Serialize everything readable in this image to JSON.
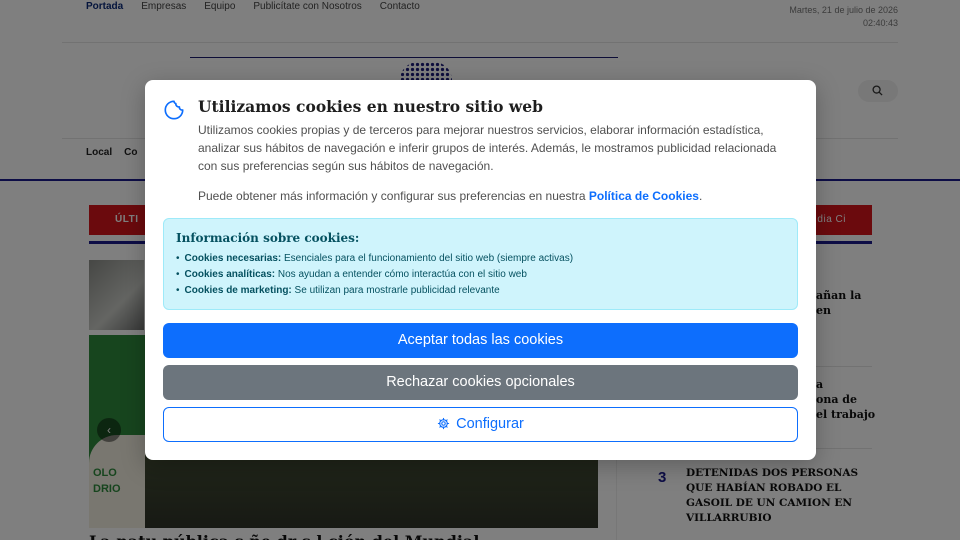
{
  "topnav": {
    "items": [
      "Portada",
      "Empresas",
      "Equipo",
      "Publicítate con Nosotros",
      "Contacto"
    ],
    "active": "Portada"
  },
  "datetime": {
    "date": "Martes, 21 de julio de 2026",
    "time": "02:40:43"
  },
  "mainnav": {
    "items": [
      "Local",
      "Co"
    ]
  },
  "ticker": {
    "label": "ÚLTI",
    "right_text": "dia Ci"
  },
  "main_article": {
    "image_text": "OLO\nDRIO",
    "headline_fragment": "La  natu  pública  s  ñe  dr  s  l  ción del Mundial"
  },
  "sidebar": {
    "fragments": [
      "añan la",
      "en",
      "a",
      "ona de",
      "el trabajo"
    ],
    "ranked": [
      {
        "rank": "3",
        "title": "DETENIDAS DOS PERSONAS QUE HABÍAN ROBADO EL GASOIL DE UN CAMION EN VILLARRUBIO"
      }
    ]
  },
  "cookie_modal": {
    "title": "Utilizamos cookies en nuestro sitio web",
    "description": "Utilizamos cookies propias y de terceros para mejorar nuestros servicios, elaborar información estadística, analizar sus hábitos de navegación e inferir grupos de interés. Además, le mostramos publicidad relacionada con sus preferencias según sus hábitos de navegación.",
    "policy_prefix": "Puede obtener más información y configurar sus preferencias en nuestra ",
    "policy_link": "Política de Cookies",
    "policy_suffix": ".",
    "info_title": "Información sobre cookies:",
    "info_items": [
      {
        "name": "Cookies necesarias:",
        "desc": " Esenciales para el funcionamiento del sitio web (siempre activas)"
      },
      {
        "name": "Cookies analíticas:",
        "desc": " Nos ayudan a entender cómo interactúa con el sitio web"
      },
      {
        "name": "Cookies de marketing:",
        "desc": " Se utilizan para mostrarle publicidad relevante"
      }
    ],
    "accept_label": "Aceptar todas las cookies",
    "reject_label": "Rechazar cookies opcionales",
    "configure_label": "Configurar",
    "colors": {
      "primary": "#0d6efd",
      "secondary": "#6c757d",
      "info_bg": "#cff4fc",
      "info_text": "#055160"
    },
    "icons": {
      "header": "cookie-icon",
      "configure": "gear-icon"
    }
  },
  "colors": {
    "brand_navy": "#1a1a8c",
    "ticker_red": "#d7141b"
  }
}
